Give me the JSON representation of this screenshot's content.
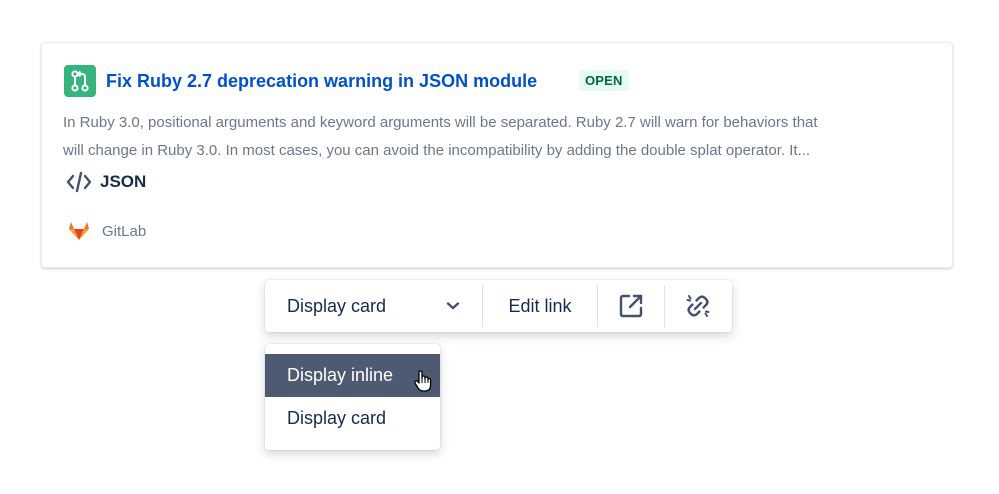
{
  "card": {
    "title": "Fix Ruby 2.7 deprecation warning in JSON module",
    "status": "OPEN",
    "description": [
      "In Ruby 3.0, positional arguments and keyword arguments will be separated. Ruby 2.7 will warn for behaviors that",
      "will change in Ruby 3.0. In most cases, you can avoid the incompatibility by adding the double splat operator. It..."
    ],
    "language": "JSON",
    "source": "GitLab",
    "icons": {
      "type": "pull-request-icon",
      "language": "code-icon",
      "source": "gitlab-logo-icon"
    },
    "colors": {
      "accent": "#36B37E",
      "title": "#0052CC",
      "badge_bg": "#E3FCEF",
      "badge_text": "#006644"
    }
  },
  "toolbar": {
    "select_label": "Display card",
    "edit_label": "Edit link",
    "icons": [
      "chevron-down-icon",
      "open-external-icon",
      "unlink-icon"
    ]
  },
  "menu": {
    "items": [
      {
        "label": "Display inline",
        "selected": true
      },
      {
        "label": "Display card",
        "selected": false
      }
    ],
    "selected_bg": "#4D5A72"
  }
}
